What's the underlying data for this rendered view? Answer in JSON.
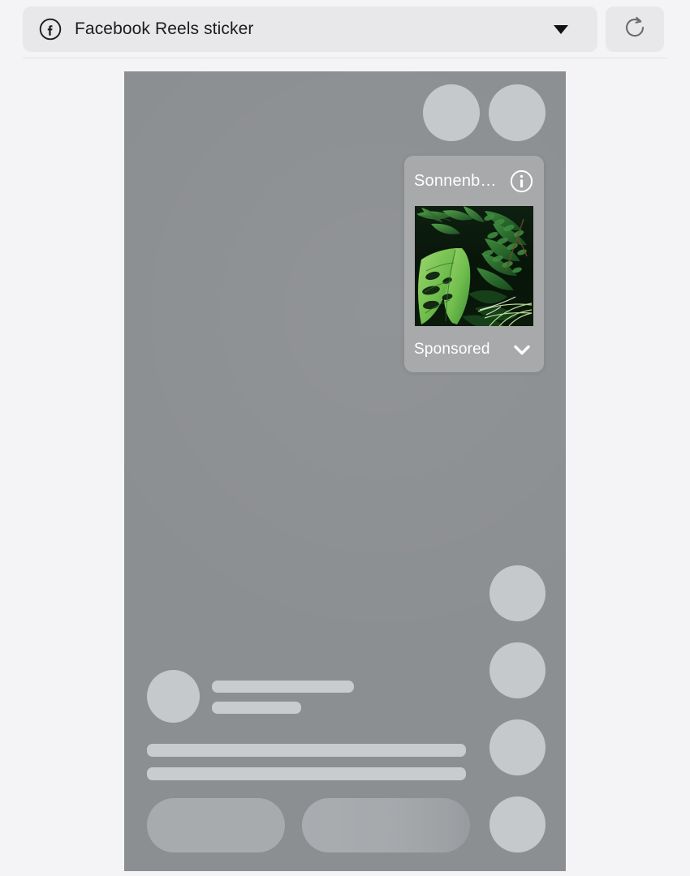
{
  "toolbar": {
    "platform_icon": "facebook-icon",
    "selected_format": "Facebook Reels sticker",
    "dropdown_icon": "chevron-down-icon",
    "refresh_icon": "refresh-icon"
  },
  "preview": {
    "frame_label": "reels-preview-frame",
    "background_color": "#8c8f92",
    "top_circles": 2,
    "right_rail_circles": 4,
    "skeleton_text_bars": 4,
    "skeleton_pills": 2
  },
  "sticker": {
    "title": "Sonnenb…",
    "info_icon": "info-icon",
    "footer_label": "Sponsored",
    "expand_icon": "chevron-down-icon",
    "media_alt": "tropical-foliage-image",
    "card_color": "#a8a9ab",
    "text_color": "#ffffff"
  }
}
